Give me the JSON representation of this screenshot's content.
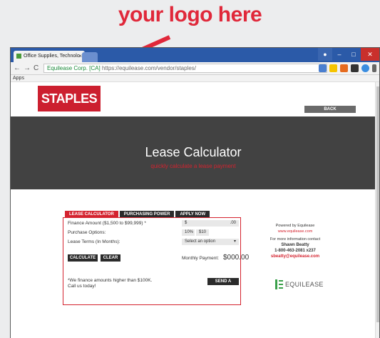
{
  "promo": {
    "text": "your logo here"
  },
  "browser": {
    "tab_title": "Office Supplies, Technolo",
    "tab_close": "×",
    "url_secure": "Equilease Corp. [CA]",
    "url_rest": "https://equilease.com/vendor/staples/",
    "bookmarks_label": "Apps"
  },
  "page": {
    "logo": "STAPLES",
    "back_label": "BACK",
    "hero_title": "Lease Calculator",
    "hero_subtitle": "quickly calculate a lease payment"
  },
  "calculator": {
    "tabs": [
      "LEASE CALCULATOR",
      "PURCHASING POWER",
      "APPLY NOW"
    ],
    "finance_label": "Finance Amount ($1,500 to $99,999) *",
    "finance_prefix": "$",
    "finance_suffix": ".00",
    "options_label": "Purchase Options:",
    "option_1": "10%",
    "option_2": "$10",
    "terms_label": "Lease Terms (In Months):",
    "terms_placeholder": "Select an option",
    "calculate_label": "CALCULATE",
    "clear_label": "CLEAR",
    "monthly_label": "Monthly Payment:",
    "monthly_value": "$000.00",
    "note_line1": "*We finance amounts higher than $100K.",
    "note_line2": "Call us today!",
    "quote_label": "SEND A QUOTE"
  },
  "sidebar": {
    "powered": "Powered by Equilease",
    "site": "www.equilease.com",
    "contact_note": "For more information contact",
    "name": "Shawn Beatty",
    "phone": "1-800-463-2081 x237",
    "email": "sbeatty@equilease.com",
    "brand": "EQUILEASE"
  },
  "colors": {
    "brand_red": "#d4232f",
    "dark": "#2b2b2b",
    "equilease_green": "#3aa04a"
  }
}
